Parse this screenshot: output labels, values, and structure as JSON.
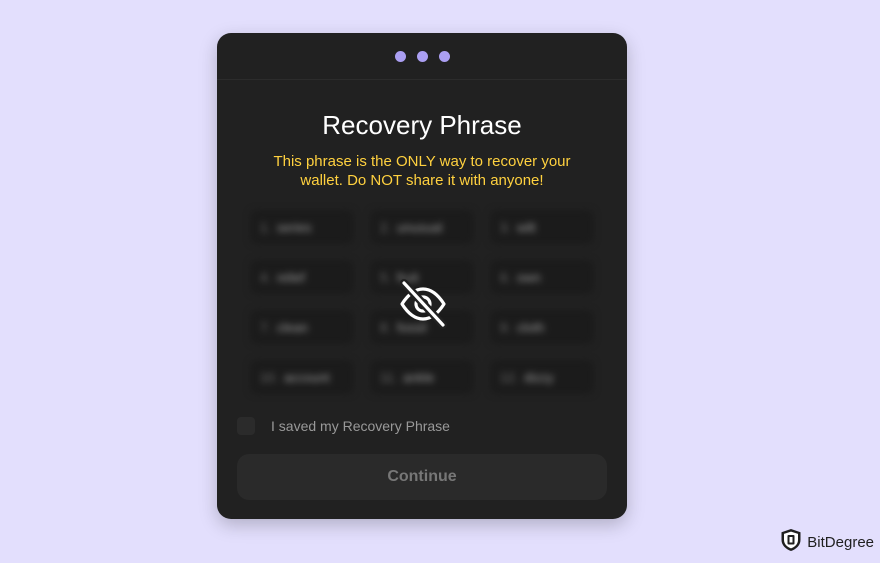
{
  "window": {
    "dots": 3,
    "title": "Recovery Phrase",
    "warning_line1": "This phrase is the ONLY way to recover your",
    "warning_line2": "wallet. Do NOT share it with anyone!",
    "hidden_icon": "eye-slash-icon"
  },
  "phrase_words": [
    {
      "num": "1.",
      "word": "series"
    },
    {
      "num": "2.",
      "word": "unusual"
    },
    {
      "num": "3.",
      "word": "wilt"
    },
    {
      "num": "4.",
      "word": "relief"
    },
    {
      "num": "5.",
      "word": "fruit"
    },
    {
      "num": "6.",
      "word": "own"
    },
    {
      "num": "7.",
      "word": "clean"
    },
    {
      "num": "8.",
      "word": "fossil"
    },
    {
      "num": "9.",
      "word": "cloth"
    },
    {
      "num": "10.",
      "word": "account"
    },
    {
      "num": "11.",
      "word": "ankle"
    },
    {
      "num": "12.",
      "word": "dizzy"
    }
  ],
  "confirm": {
    "label": "I saved my Recovery Phrase",
    "checked": false
  },
  "continue_label": "Continue",
  "brand": {
    "name": "BitDegree",
    "icon": "bitdegree-shield-logo"
  },
  "colors": {
    "page_background": "#e3dffd",
    "window_background": "#212121",
    "accent_dots": "#ab9ff2",
    "warning_text": "#ffd13f"
  }
}
